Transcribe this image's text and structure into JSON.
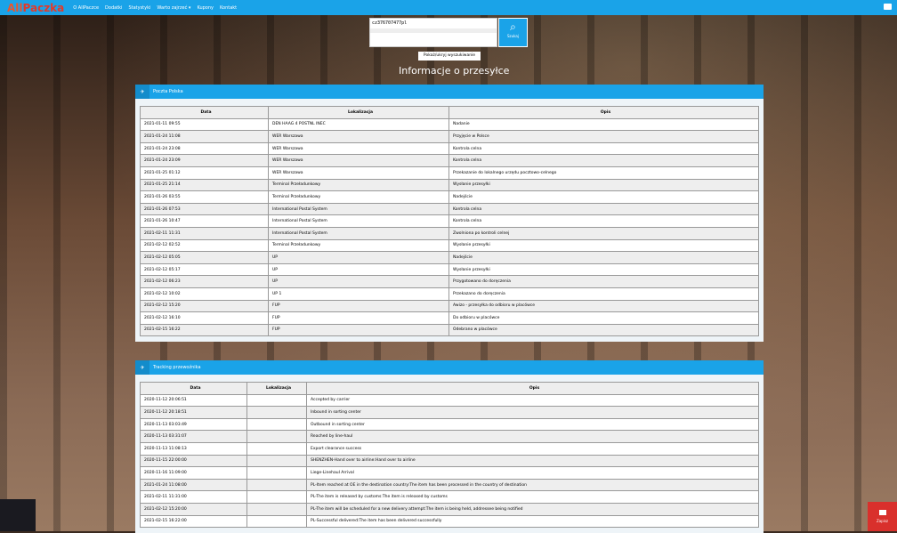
{
  "nav": {
    "logo_a": "All",
    "logo_b": "Paczka",
    "items": [
      "O AllPaczce",
      "Dodatki",
      "Statystyki",
      "Warto zajrzeć ▾",
      "Kupony",
      "Kontakt"
    ]
  },
  "search": {
    "value": "cz376707477pl",
    "button": "Szukaj",
    "advanced": "Pokaż/ukryj wyszukiwanie"
  },
  "page_title": "Informacje o przesyłce",
  "panel1": {
    "title": "Poczta Polska",
    "headers": [
      "Data",
      "Lokalizacja",
      "Opis"
    ],
    "rows": [
      [
        "2021-01-11 09:55",
        "DEN HAAG 4 POSTNL INEC",
        "Nadanie"
      ],
      [
        "2021-01-24 11:08",
        "WER Warszawa",
        "Przyjęcie w Polsce"
      ],
      [
        "2021-01-24 23:08",
        "WER Warszawa",
        "Kontrola celna"
      ],
      [
        "2021-01-24 23:09",
        "WER Warszawa",
        "Kontrola celna"
      ],
      [
        "2021-01-25 01:12",
        "WER Warszawa",
        "Przekazanie do lokalnego urzędu pocztowo-celnego"
      ],
      [
        "2021-01-25 21:14",
        "Terminal Przeładunkowy",
        "Wysłanie przesyłki"
      ],
      [
        "2021-01-26 03:55",
        "Terminal Przeładunkowy",
        "Nadejście"
      ],
      [
        "2021-01-26 07:53",
        "International Postal System",
        "Kontrola celna"
      ],
      [
        "2021-01-26 10:47",
        "International Postal System",
        "Kontrola celna"
      ],
      [
        "2021-02-11 11:31",
        "International Postal System",
        "Zwolniona po kontroli celnej"
      ],
      [
        "2021-02-12 02:52",
        "Terminal Przeładunkowy",
        "Wysłanie przesyłki"
      ],
      [
        "2021-02-12 05:05",
        "UP",
        "Nadejście"
      ],
      [
        "2021-02-12 05:17",
        "UP",
        "Wysłanie przesyłki"
      ],
      [
        "2021-02-12 06:23",
        "UP",
        "Przygotowano do doręczenia"
      ],
      [
        "2021-02-12 10:02",
        "UP 1",
        "Przekazano do doręczenia"
      ],
      [
        "2021-02-12 15:20",
        "FUP",
        "Awizo - przesyłka do odbioru w placówce"
      ],
      [
        "2021-02-12 16:10",
        "FUP",
        "Do odbioru w placówce"
      ],
      [
        "2021-02-15 16:22",
        "FUP",
        "Odebrano w placówce"
      ]
    ]
  },
  "panel2": {
    "title": "Tracking przewoźnika",
    "headers": [
      "Data",
      "Lokalizacja",
      "Opis"
    ],
    "rows": [
      [
        "2020-11-12 20:06:51",
        "",
        "Accepted by carrier"
      ],
      [
        "2020-11-12 20:18:51",
        "",
        "Inbound in sorting center"
      ],
      [
        "2020-11-13 03:03:49",
        "",
        "Outbound in sorting center"
      ],
      [
        "2020-11-13 03:31:07",
        "",
        "Reached by line-haul"
      ],
      [
        "2020-11-13 11:08:13",
        "",
        "Export clearance success"
      ],
      [
        "2020-11-15 22:00:00",
        "",
        "SHENZHEN-Hand over to airline:Hand over to airline"
      ],
      [
        "2020-11-16 11:09:00",
        "",
        "Liege-Linehaul Arrival"
      ],
      [
        "2021-01-24 11:08:00",
        "",
        "PL-Item reached at OE in the destination country:The item has been processed in the country of destination"
      ],
      [
        "2021-02-11 11:31:00",
        "",
        "PL-The item is released by customs:The item is released by customs"
      ],
      [
        "2021-02-12 15:20:00",
        "",
        "PL-The item will be scheduled for a new delivery attempt:The item is being held, addressee being notified"
      ],
      [
        "2021-02-15 16:22:00",
        "",
        "PL-Successful delivered:The item has been delivered successfully"
      ]
    ]
  },
  "save_button": "Zapisz",
  "colors": {
    "accent": "#1aa3e8",
    "save": "#d9302c"
  }
}
